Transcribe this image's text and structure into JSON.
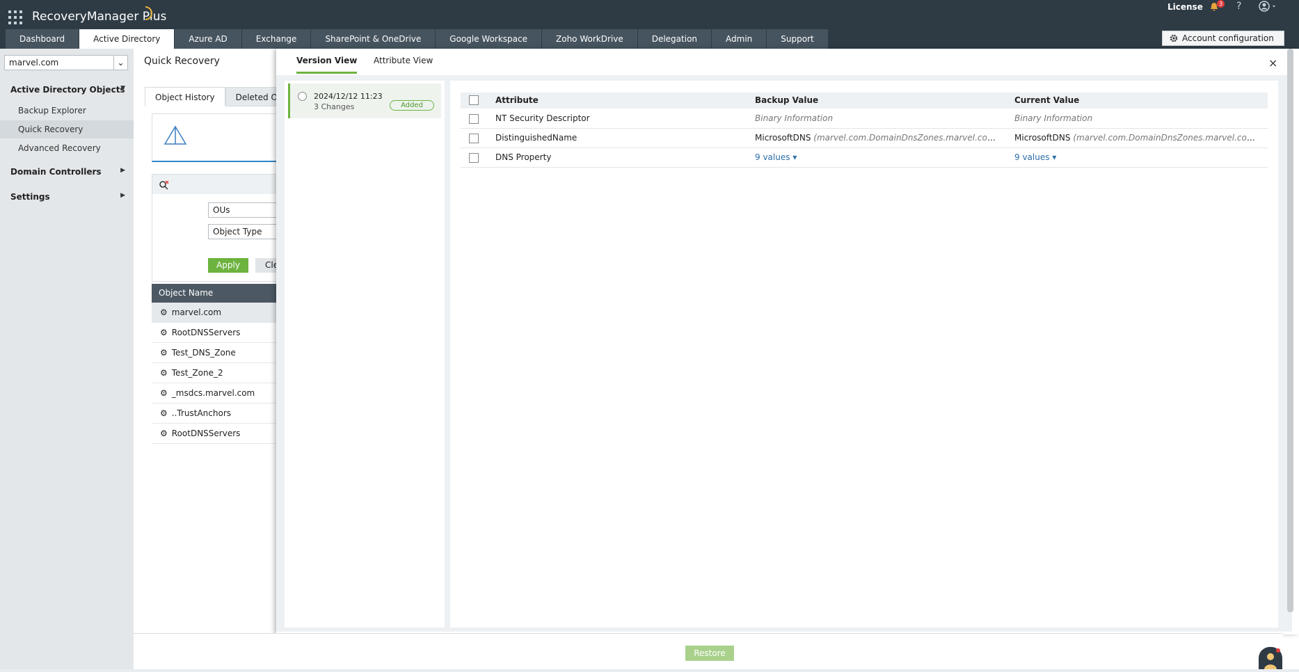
{
  "app": {
    "brand": "RecoveryManager Plus",
    "license": "License",
    "notification_count": "3",
    "help": "?"
  },
  "nav_tabs": [
    "Dashboard",
    "Active Directory",
    "Azure AD",
    "Exchange",
    "SharePoint & OneDrive",
    "Google Workspace",
    "Zoho WorkDrive",
    "Delegation",
    "Admin",
    "Support"
  ],
  "account_config": "Account configuration",
  "sidebar": {
    "domain": "marvel.com",
    "group1": "Active Directory Objects",
    "items": [
      "Backup Explorer",
      "Quick Recovery",
      "Advanced Recovery"
    ],
    "group2": "Domain Controllers",
    "group3": "Settings"
  },
  "main": {
    "title": "Quick Recovery",
    "tabs": [
      "Object History",
      "Deleted Obj"
    ],
    "filter1": "OUs",
    "filter2": "Object Type",
    "apply": "Apply",
    "clear": "Cle",
    "table_header": "Object Name",
    "objects": [
      "marvel.com",
      "RootDNSServers",
      "Test_DNS_Zone",
      "Test_Zone_2",
      "_msdcs.marvel.com",
      "..TrustAnchors",
      "RootDNSServers"
    ]
  },
  "panel": {
    "tabs": [
      "Version View",
      "Attribute View"
    ],
    "close": "×",
    "version": {
      "date": "2024/12/12 11:23",
      "changes": "3 Changes",
      "status": "Added"
    },
    "columns": [
      "Attribute",
      "Backup Value",
      "Current Value"
    ],
    "rows": [
      {
        "attr": "NT Security Descriptor",
        "backup": "Binary Information",
        "current": "Binary Information"
      },
      {
        "attr": "DistinguishedName",
        "backup": "MicrosoftDNS",
        "backup_sub": "(marvel.com.DomainDnsZones.marvel.com/Mic...",
        "current": "MicrosoftDNS",
        "current_sub": "(marvel.com.DomainDnsZones.marvel.com/Mic..."
      },
      {
        "attr": "DNS Property",
        "backup": "9 values",
        "current": "9 values"
      }
    ]
  },
  "restore": "Restore"
}
